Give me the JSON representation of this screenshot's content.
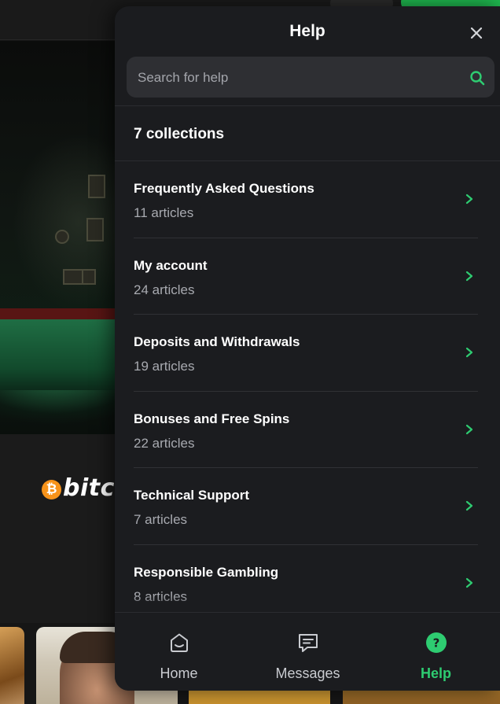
{
  "background": {
    "promo_logo_text": "bitco",
    "promo_logo_symbol": "₿"
  },
  "help": {
    "title": "Help",
    "close_icon": "close-icon",
    "search": {
      "placeholder": "Search for help",
      "value": "",
      "icon": "search-icon"
    },
    "collections_heading": "7 collections",
    "collections": [
      {
        "title": "Frequently Asked Questions",
        "count": "11 articles"
      },
      {
        "title": "My account",
        "count": "24 articles"
      },
      {
        "title": "Deposits and Withdrawals",
        "count": "19 articles"
      },
      {
        "title": "Bonuses and Free Spins",
        "count": "22 articles"
      },
      {
        "title": "Technical Support",
        "count": "7 articles"
      },
      {
        "title": "Responsible Gambling",
        "count": "8 articles"
      }
    ],
    "tabs": [
      {
        "label": "Home",
        "icon": "home-icon",
        "active": false
      },
      {
        "label": "Messages",
        "icon": "messages-icon",
        "active": false
      },
      {
        "label": "Help",
        "icon": "help-icon",
        "active": true
      }
    ],
    "colors": {
      "accent": "#2ecc71",
      "panel_bg": "#1b1c1f",
      "search_bg": "#2e2f33"
    }
  }
}
